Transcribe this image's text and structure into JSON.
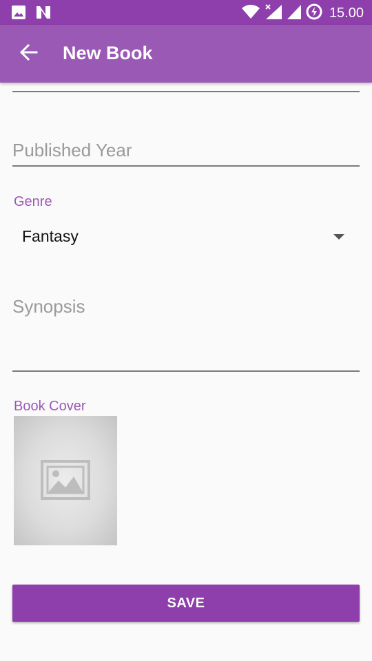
{
  "status_bar": {
    "time": "15.00",
    "icons": [
      "image-icon",
      "n-icon",
      "wifi-icon",
      "signal-x-icon",
      "signal-icon",
      "battery-charging-icon"
    ]
  },
  "app_bar": {
    "title": "New Book",
    "back_icon": "arrow-back-icon"
  },
  "form": {
    "published_year": {
      "placeholder": "Published Year",
      "value": ""
    },
    "genre": {
      "label": "Genre",
      "selected": "Fantasy"
    },
    "synopsis": {
      "placeholder": "Synopsis",
      "value": ""
    },
    "book_cover": {
      "label": "Book Cover",
      "icon": "image-placeholder-icon"
    },
    "save_label": "SAVE"
  },
  "colors": {
    "status_bar": "#8e3fab",
    "app_bar": "#9b59b6",
    "accent": "#9b59b6",
    "button": "#8e3fab"
  }
}
